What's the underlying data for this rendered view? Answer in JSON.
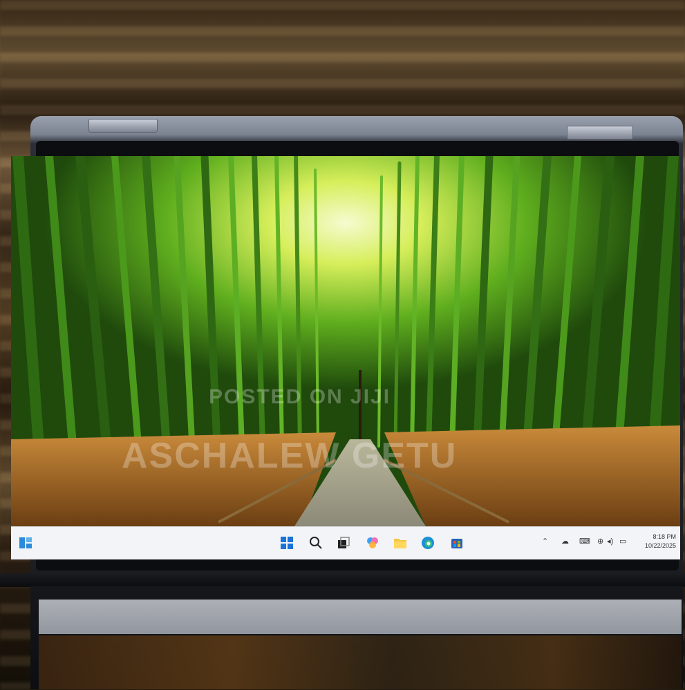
{
  "photo": {
    "subject": "convertible laptop on desk displaying bamboo forest wallpaper with Windows 11 taskbar"
  },
  "watermark": {
    "line1": "POSTED ON JIJI",
    "line2": "ASCHALEW GETU"
  },
  "taskbar": {
    "icons": [
      "widgets-icon",
      "start-icon",
      "search-icon",
      "task-view-icon",
      "copilot-icon",
      "file-explorer-icon",
      "edge-icon",
      "store-icon"
    ],
    "tray_icons": [
      "chevron-up-icon",
      "onedrive-icon",
      "keyboard-icon",
      "network-icon",
      "volume-icon",
      "battery-icon"
    ],
    "time": "8:18 PM",
    "date": "10/22/2025"
  },
  "colors": {
    "taskbar_bg": "#f2f4f7",
    "bamboo_green": "#4f9a1c",
    "light_glow": "#e8f57a",
    "path_grass": "#a86a2a"
  }
}
